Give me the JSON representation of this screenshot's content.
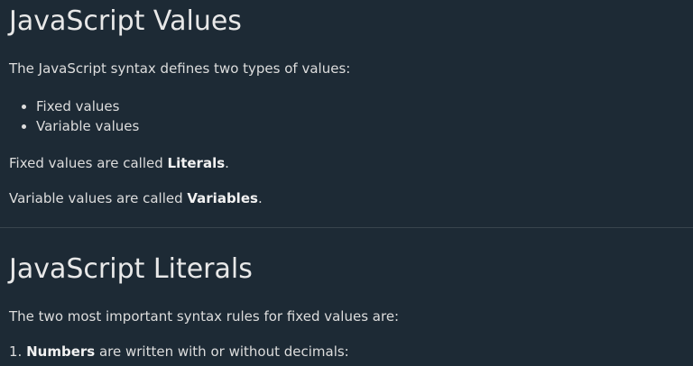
{
  "section_values": {
    "title": "JavaScript Values",
    "intro": "The JavaScript syntax defines two types of values:",
    "list_items": [
      "Fixed values",
      "Variable values"
    ],
    "fixed_prefix": "Fixed values are called ",
    "fixed_bold": "Literals",
    "fixed_suffix": ".",
    "variable_prefix": "Variable values are called ",
    "variable_bold": "Variables",
    "variable_suffix": "."
  },
  "section_literals": {
    "title": "JavaScript Literals",
    "rules_intro": "The two most important syntax rules for fixed values are:",
    "numbers_prefix": "1. ",
    "numbers_bold": "Numbers",
    "numbers_suffix": " are written with or without decimals:"
  },
  "colors": {
    "background": "#1d2a35",
    "text": "#dddddd",
    "divider": "#38444d"
  }
}
